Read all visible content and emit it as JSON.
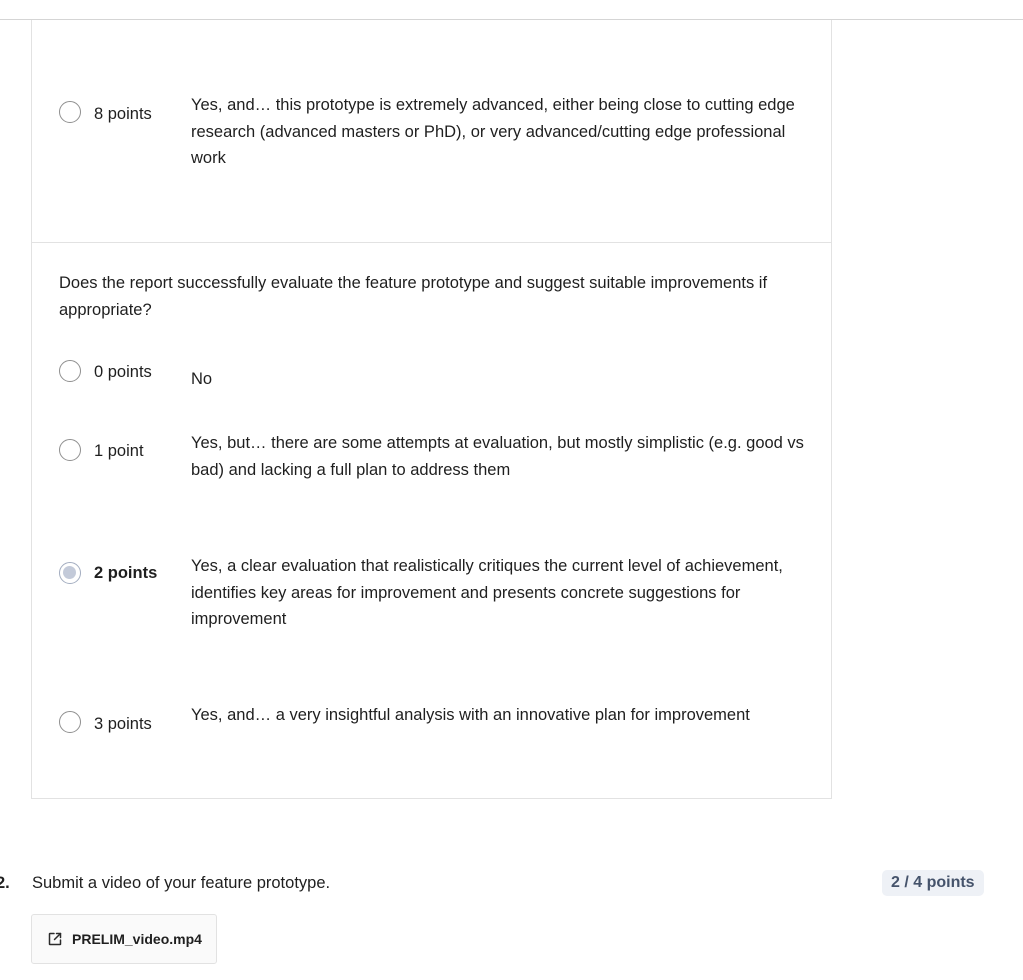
{
  "criterion_prev": {
    "options": [
      {
        "points": "8 points",
        "description": "Yes, and… this prototype is extremely advanced, either being close to cutting edge research (advanced masters or PhD), or very advanced/cutting edge professional work"
      }
    ]
  },
  "criterion_current": {
    "question": "Does the report successfully evaluate the feature prototype and suggest suitable improvements if appropriate?",
    "options": [
      {
        "points": "0 points",
        "description": "No"
      },
      {
        "points": "1 point",
        "description": "Yes, but… there are some attempts at evaluation, but mostly simplistic (e.g. good vs bad) and lacking a full plan to address them"
      },
      {
        "points": "2 points",
        "description": "Yes, a clear evaluation that realistically critiques the current level of achievement, identifies key areas for improvement and presents concrete suggestions for improvement",
        "selected": true
      },
      {
        "points": "3 points",
        "description": "Yes, and… a very insightful analysis with an innovative plan for improvement"
      }
    ]
  },
  "next_question": {
    "number": "2.",
    "text": "Submit a video of your feature prototype.",
    "score": "2 / 4 points",
    "attachment": {
      "filename": "PRELIM_video.mp4",
      "icon": "external-link-icon"
    }
  },
  "colors": {
    "border": "#e2e2e2",
    "radio_selected_fill": "#c3cad9",
    "badge_bg": "#eef1f6",
    "badge_text": "#45536b"
  }
}
